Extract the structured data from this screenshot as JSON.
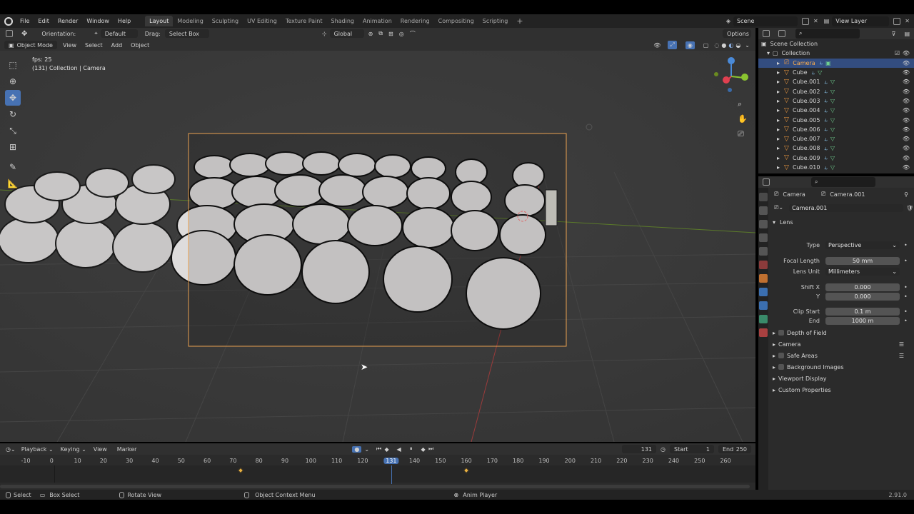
{
  "menu": [
    "File",
    "Edit",
    "Render",
    "Window",
    "Help"
  ],
  "workspaces": [
    {
      "label": "Layout",
      "active": true
    },
    {
      "label": "Modeling",
      "active": false
    },
    {
      "label": "Sculpting",
      "active": false
    },
    {
      "label": "UV Editing",
      "active": false
    },
    {
      "label": "Texture Paint",
      "active": false
    },
    {
      "label": "Shading",
      "active": false
    },
    {
      "label": "Animation",
      "active": false
    },
    {
      "label": "Rendering",
      "active": false
    },
    {
      "label": "Compositing",
      "active": false
    },
    {
      "label": "Scripting",
      "active": false
    }
  ],
  "add_workspace": "+",
  "scene": "Scene",
  "view_layer": "View Layer",
  "vp_header": {
    "orientation_label": "Orientation:",
    "orientation_value": "Default",
    "drag_label": "Drag:",
    "drag_value": "Select Box",
    "transform_space": "Global",
    "options": "Options"
  },
  "vp_header2": {
    "mode": "Object Mode",
    "view": "View",
    "select": "Select",
    "add": "Add",
    "object": "Object"
  },
  "overlay": {
    "fps": "fps: 25",
    "info": "(131) Collection | Camera"
  },
  "outliner": {
    "scene_collection": "Scene Collection",
    "collection": "Collection",
    "items": [
      {
        "name": "Camera",
        "selected": true
      },
      {
        "name": "Cube",
        "selected": false
      },
      {
        "name": "Cube.001",
        "selected": false
      },
      {
        "name": "Cube.002",
        "selected": false
      },
      {
        "name": "Cube.003",
        "selected": false
      },
      {
        "name": "Cube.004",
        "selected": false
      },
      {
        "name": "Cube.005",
        "selected": false
      },
      {
        "name": "Cube.006",
        "selected": false
      },
      {
        "name": "Cube.007",
        "selected": false
      },
      {
        "name": "Cube.008",
        "selected": false
      },
      {
        "name": "Cube.009",
        "selected": false
      },
      {
        "name": "Cube.010",
        "selected": false
      }
    ]
  },
  "properties": {
    "object_name": "Camera",
    "data_name": "Camera.001",
    "data_field": "Camera.001",
    "lens_panel": "Lens",
    "type_label": "Type",
    "type_value": "Perspective",
    "focal_label": "Focal Length",
    "focal_value": "50 mm",
    "lens_unit_label": "Lens Unit",
    "lens_unit_value": "Millimeters",
    "shift_x_label": "Shift X",
    "shift_x_value": "0.000",
    "shift_y_label": "Y",
    "shift_y_value": "0.000",
    "clip_start_label": "Clip Start",
    "clip_start_value": "0.1 m",
    "clip_end_label": "End",
    "clip_end_value": "1000 m",
    "panels": [
      {
        "label": "Depth of Field",
        "checkbox": true
      },
      {
        "label": "Camera",
        "checkbox": false
      },
      {
        "label": "Safe Areas",
        "checkbox": true
      },
      {
        "label": "Background Images",
        "checkbox": true
      },
      {
        "label": "Viewport Display",
        "checkbox": false
      },
      {
        "label": "Custom Properties",
        "checkbox": false
      }
    ]
  },
  "timeline": {
    "playback": "Playback",
    "keying": "Keying",
    "view": "View",
    "marker": "Marker",
    "current_frame": "131",
    "start_label": "Start",
    "start_value": "1",
    "end_label": "End",
    "end_value": "250",
    "ticks": [
      "-10",
      "0",
      "10",
      "20",
      "30",
      "40",
      "50",
      "60",
      "70",
      "80",
      "90",
      "100",
      "110",
      "120",
      "131",
      "140",
      "150",
      "160",
      "170",
      "180",
      "190",
      "200",
      "210",
      "220",
      "230",
      "240",
      "250",
      "260"
    ],
    "current_frame_number": 131,
    "keyframes": [
      73,
      160
    ]
  },
  "statusbar": {
    "select": "Select",
    "box_select": "Box Select",
    "rotate_view": "Rotate View",
    "context_menu": "Object Context Menu",
    "anim_player": "Anim Player",
    "version": "2.91.0"
  },
  "colors": {
    "accent": "#4772b3",
    "selection_row": "#334d80",
    "camera_frame": "#e8a050",
    "keyframe": "#e8b040"
  }
}
